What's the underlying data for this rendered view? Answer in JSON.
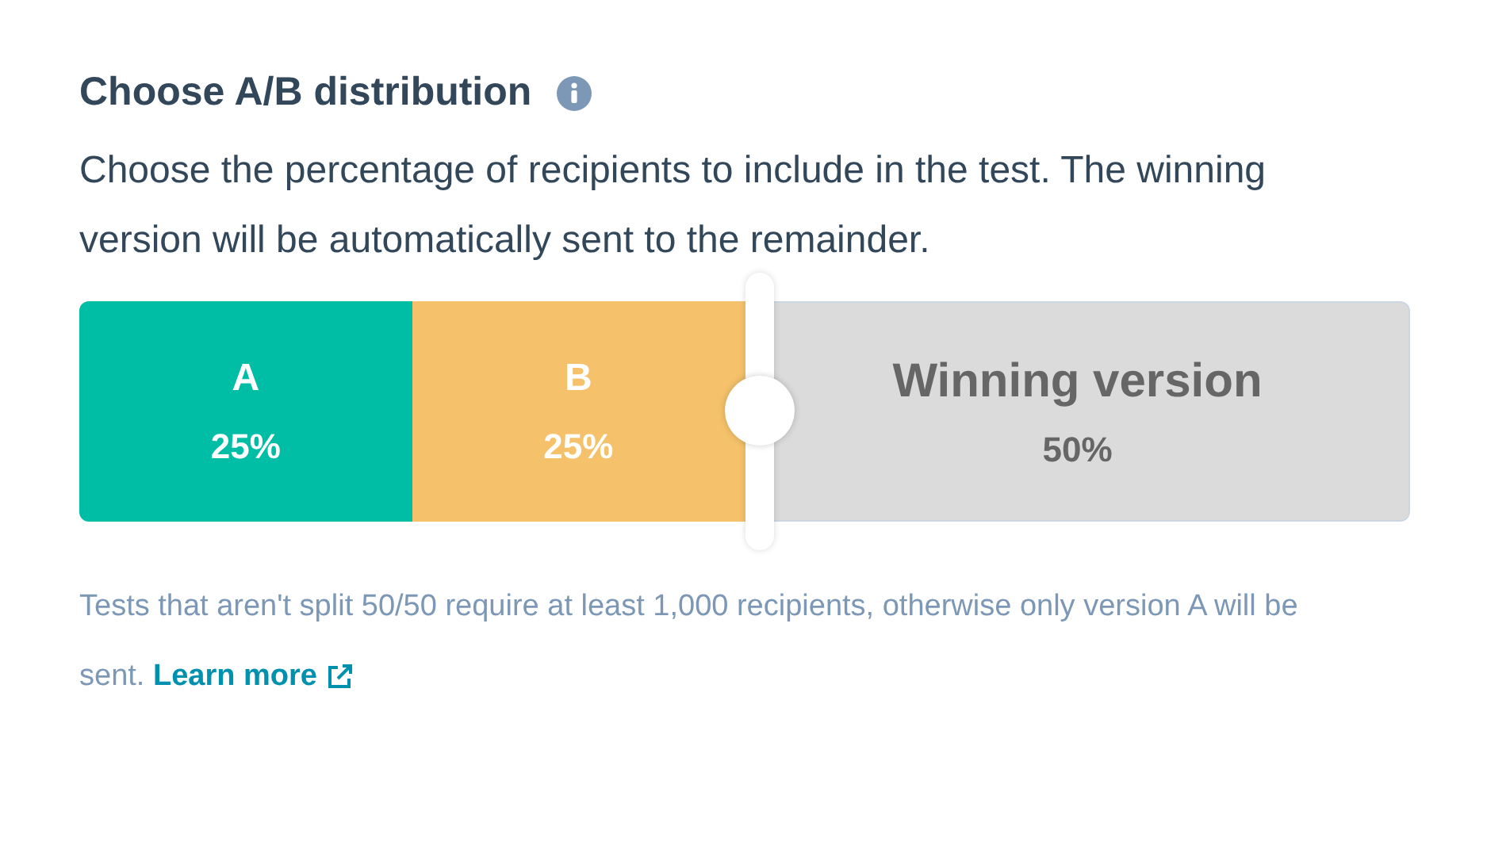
{
  "heading": "Choose A/B distribution",
  "description": "Choose the percentage of recipients to include in the test. The winning version will be automatically sent to the remainder.",
  "distribution": {
    "level": 0.5,
    "segments": [
      {
        "kind": "variant",
        "label": "A",
        "percent": "25%",
        "color": "#00bda5"
      },
      {
        "kind": "variant",
        "label": "B",
        "percent": "25%",
        "color": "#f5c26b"
      },
      {
        "kind": "remainder",
        "label": "Winning version",
        "percent": "50%",
        "color": "#dbdbdb"
      }
    ]
  },
  "note": "Tests that aren't split 50/50 require at least 1,000 recipients, otherwise only version A will be sent.",
  "link": "Learn more"
}
